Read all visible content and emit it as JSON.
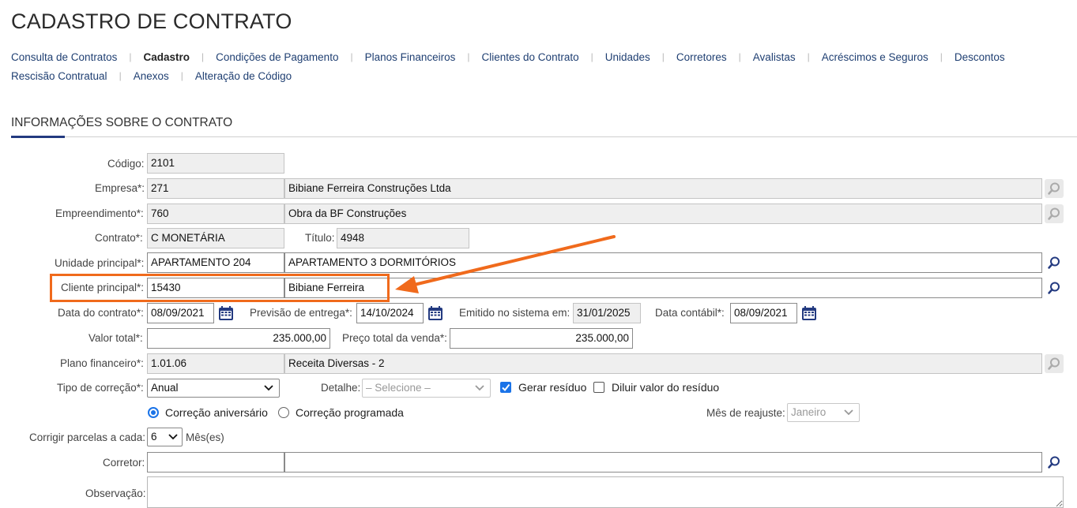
{
  "page": {
    "title": "CADASTRO DE CONTRATO"
  },
  "tabs_row1": [
    {
      "label": "Consulta de Contratos",
      "active": false
    },
    {
      "label": "Cadastro",
      "active": true
    },
    {
      "label": "Condições de Pagamento",
      "active": false
    },
    {
      "label": "Planos Financeiros",
      "active": false
    },
    {
      "label": "Clientes do Contrato",
      "active": false
    },
    {
      "label": "Unidades",
      "active": false
    },
    {
      "label": "Corretores",
      "active": false
    },
    {
      "label": "Avalistas",
      "active": false
    },
    {
      "label": "Acréscimos e Seguros",
      "active": false
    },
    {
      "label": "Descontos",
      "active": false
    }
  ],
  "tabs_row2": [
    {
      "label": "Rescisão Contratual",
      "active": false
    },
    {
      "label": "Anexos",
      "active": false
    },
    {
      "label": "Alteração de Código",
      "active": false
    }
  ],
  "section": {
    "title": "INFORMAÇÕES SOBRE O CONTRATO"
  },
  "form": {
    "codigo": {
      "label": "Código:",
      "value": "2101"
    },
    "empresa": {
      "label": "Empresa*:",
      "code": "271",
      "name": "Bibiane Ferreira Construções Ltda"
    },
    "empreendimento": {
      "label": "Empreendimento*:",
      "code": "760",
      "name": "Obra da BF Construções"
    },
    "contrato": {
      "label": "Contrato*:",
      "value": "C MONETÁRIA"
    },
    "titulo": {
      "label": "Título:",
      "value": "4948"
    },
    "unidade": {
      "label": "Unidade principal*:",
      "code": "APARTAMENTO 204",
      "name": "APARTAMENTO 3 DORMITÓRIOS"
    },
    "cliente": {
      "label": "Cliente principal*:",
      "code": "15430",
      "name": "Bibiane Ferreira"
    },
    "data_contrato": {
      "label": "Data do contrato*:",
      "value": "08/09/2021"
    },
    "previsao": {
      "label": "Previsão de entrega*:",
      "value": "14/10/2024"
    },
    "emitido": {
      "label": "Emitido no sistema em:",
      "value": "31/01/2025"
    },
    "data_contabil": {
      "label": "Data contábil*:",
      "value": "08/09/2021"
    },
    "valor_total": {
      "label": "Valor total*:",
      "value": "235.000,00"
    },
    "preco_total": {
      "label": "Preço total da venda*:",
      "value": "235.000,00"
    },
    "plano": {
      "label": "Plano financeiro*:",
      "code": "1.01.06",
      "name": "Receita Diversas - 2"
    },
    "tipo_correcao": {
      "label": "Tipo de correção*:",
      "value": "Anual"
    },
    "detalhe": {
      "label": "Detalhe:",
      "placeholder": "– Selecione –"
    },
    "gerar_residuo": {
      "label": "Gerar resíduo",
      "checked": true
    },
    "diluir_residuo": {
      "label": "Diluir valor do resíduo",
      "checked": false
    },
    "correcao_aniversario": {
      "label": "Correção aniversário",
      "selected": true
    },
    "correcao_programada": {
      "label": "Correção programada",
      "selected": false
    },
    "mes_reajuste": {
      "label": "Mês de reajuste:",
      "value": "Janeiro"
    },
    "corrigir": {
      "label": "Corrigir parcelas a cada:",
      "value": "6",
      "unit": "Mês(es)"
    },
    "corretor": {
      "label": "Corretor:",
      "code": "",
      "name": ""
    },
    "observacao": {
      "label": "Observação:",
      "value": ""
    }
  },
  "colors": {
    "accent": "#233a80",
    "highlight": "#f06a1c",
    "link": "#1f3f72",
    "check": "#1a73e8"
  },
  "icons": {
    "lookup": "magnifier-icon",
    "calendar": "calendar-icon",
    "dropdown": "chevron-down-icon"
  }
}
